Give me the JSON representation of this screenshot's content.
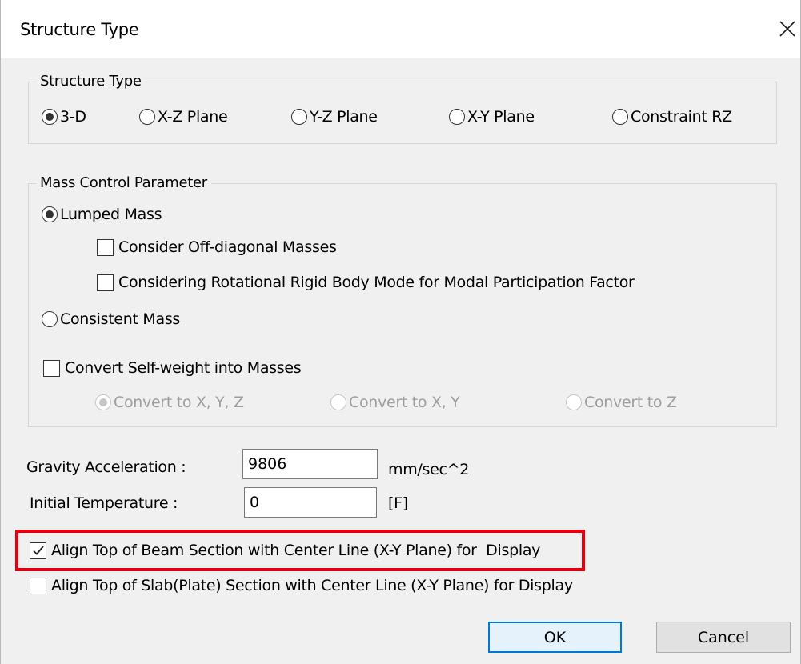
{
  "window": {
    "title": "Structure Type",
    "close_glyph": "✕"
  },
  "structure_type": {
    "label": "Structure Type",
    "options": [
      {
        "label": "3-D",
        "checked": true
      },
      {
        "label": "X-Z Plane",
        "checked": false
      },
      {
        "label": "Y-Z Plane",
        "checked": false
      },
      {
        "label": "X-Y Plane",
        "checked": false
      },
      {
        "label": "Constraint RZ",
        "checked": false
      }
    ]
  },
  "mass_control": {
    "label": "Mass Control Parameter",
    "lumped_mass": "Lumped Mass",
    "off_diagonal": "Consider Off-diagonal Masses",
    "rotational_rigid": "Considering Rotational Rigid Body Mode for Modal Participation Factor",
    "consistent_mass": "Consistent Mass",
    "convert_self_weight": "Convert Self-weight into Masses",
    "convert_options": [
      {
        "label": "Convert to X, Y, Z",
        "checked": true
      },
      {
        "label": "Convert to X, Y",
        "checked": false
      },
      {
        "label": "Convert to Z",
        "checked": false
      }
    ]
  },
  "gravity": {
    "label": "Gravity Acceleration :",
    "value": "9806",
    "unit": "mm/sec^2"
  },
  "temperature": {
    "label": "Initial Temperature :",
    "value": "0",
    "unit": "[F]"
  },
  "align": {
    "beam": "Align Top of Beam Section with Center Line (X-Y Plane) for  Display",
    "slab": "Align Top of Slab(Plate) Section with Center Line (X-Y Plane) for Display"
  },
  "buttons": {
    "ok": "OK",
    "cancel": "Cancel"
  },
  "colors": {
    "highlight": "#e3000f",
    "default_button_border": "#0078d7",
    "dialog_bg": "#f0f0f0"
  }
}
